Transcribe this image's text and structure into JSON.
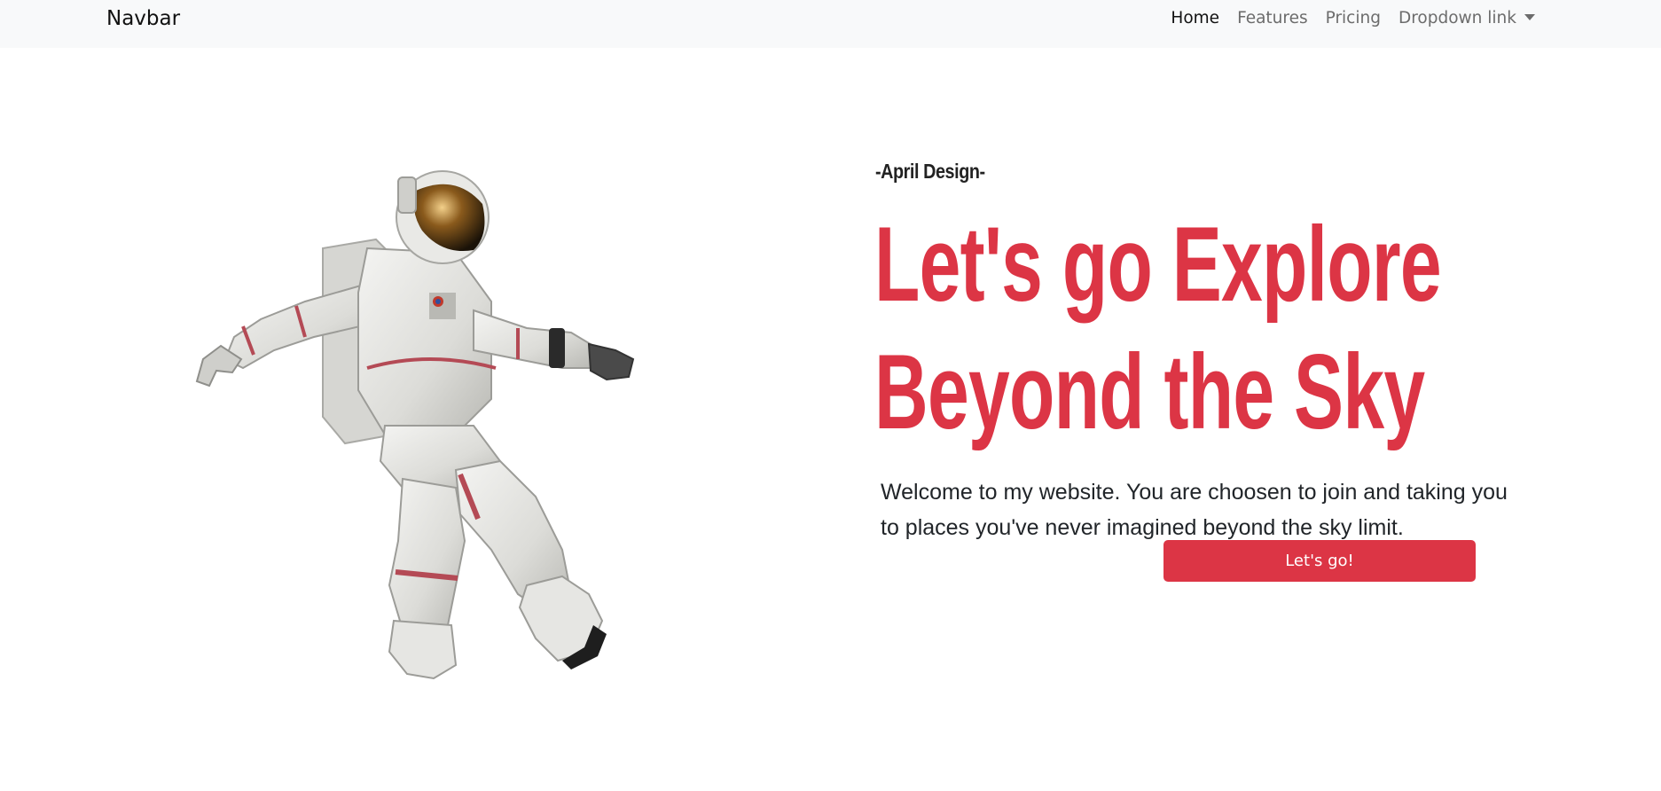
{
  "navbar": {
    "brand": "Navbar",
    "links": [
      {
        "label": "Home",
        "active": true
      },
      {
        "label": "Features",
        "active": false
      },
      {
        "label": "Pricing",
        "active": false
      },
      {
        "label": "Dropdown link",
        "active": false
      }
    ]
  },
  "hero": {
    "image_icon": "astronaut-illustration",
    "eyebrow": "-April Design-",
    "headline_line1": "Let's go Explore",
    "headline_line2": "Beyond the Sky",
    "lead": "Welcome to my website. You are choosen to join and taking you to places you've never imagined beyond the sky limit.",
    "cta_label": "Let's go!"
  },
  "colors": {
    "accent": "#dc3545",
    "navbar_bg": "#f8f9fa",
    "text": "#212529"
  }
}
